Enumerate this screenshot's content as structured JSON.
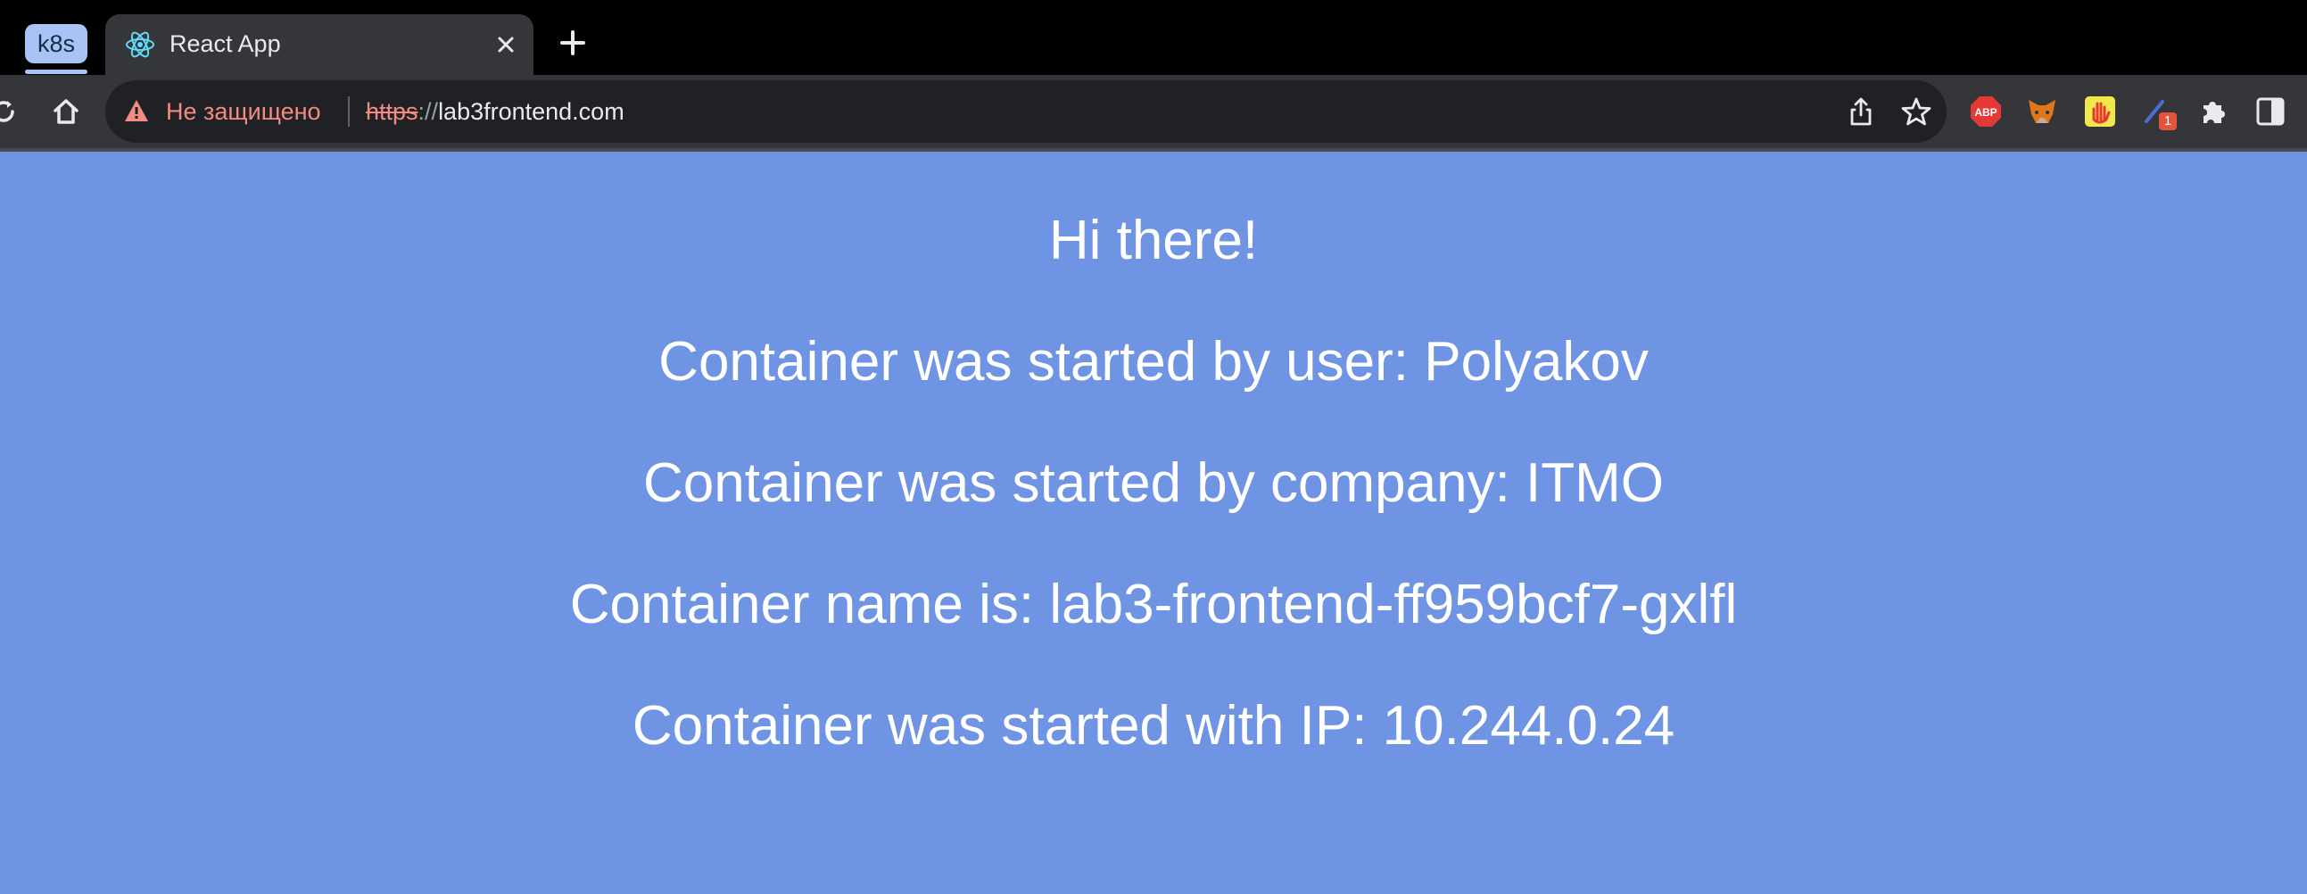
{
  "tabstrip": {
    "group_label": "k8s",
    "tab_title": "React App",
    "tab_favicon": "react-logo-icon",
    "close_icon": "close-icon",
    "new_tab_icon": "plus-icon"
  },
  "toolbar": {
    "security_label": "Не защищено",
    "url_scheme": "https",
    "url_separator": "://",
    "url_host": "lab3frontend.com",
    "extensions": [
      {
        "name": "adblock-plus-icon",
        "label": "ABP"
      },
      {
        "name": "metamask-icon"
      },
      {
        "name": "hand-extension-icon"
      },
      {
        "name": "pen-extension-icon",
        "badge": "1"
      },
      {
        "name": "puzzle-extensions-icon"
      },
      {
        "name": "side-panel-icon"
      }
    ]
  },
  "page": {
    "greeting": "Hi there!",
    "user_line": "Container was started by user: Polyakov",
    "company_line": "Container was started by company: ITMO",
    "name_line": "Container name is: lab3-frontend-ff959bcf7-gxlfl",
    "ip_line": "Container was started with IP: 10.244.0.24"
  },
  "colors": {
    "page_background": "#6f94e4",
    "tab_group": "#a8c3f4",
    "insecure_warning": "#f28b82",
    "toolbar": "#35363a",
    "omnibox": "#202124"
  }
}
